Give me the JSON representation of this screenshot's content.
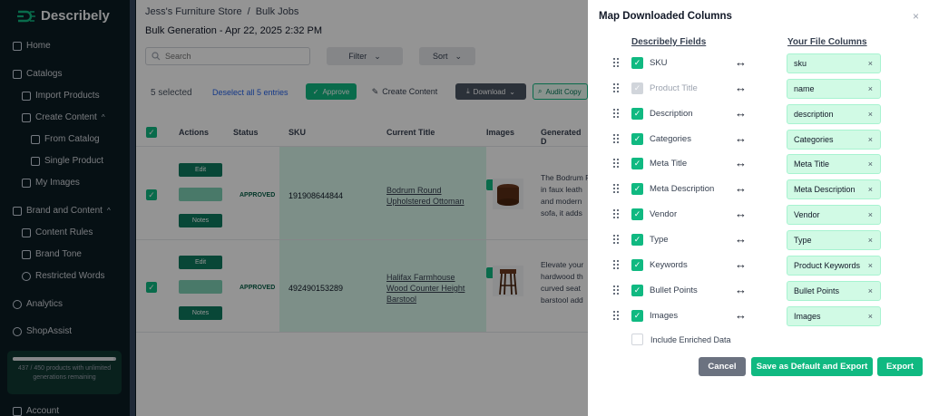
{
  "sidebar": {
    "brand": "Describely",
    "items": [
      {
        "label": "Home"
      },
      {
        "label": "Catalogs"
      },
      {
        "label": "Import Products"
      },
      {
        "label": "Create Content"
      },
      {
        "label": "From Catalog"
      },
      {
        "label": "Single Product"
      },
      {
        "label": "My Images"
      },
      {
        "label": "Brand and Content"
      },
      {
        "label": "Content Rules"
      },
      {
        "label": "Brand Tone"
      },
      {
        "label": "Restricted Words"
      },
      {
        "label": "Analytics"
      },
      {
        "label": "ShopAssist"
      },
      {
        "label": "Account"
      }
    ],
    "quota": {
      "text": "437 / 450 products with unlimited generations remaining",
      "used_fraction": 0.97
    }
  },
  "main": {
    "breadcrumb": {
      "store": "Jess's Furniture Store",
      "sep": "/",
      "page": "Bulk Jobs"
    },
    "title": "Bulk Generation - Apr 22, 2025 2:32 PM",
    "search_placeholder": "Search",
    "filter_label": "Filter",
    "sort_label": "Sort",
    "selection": {
      "count_text": "5 selected",
      "deselect_text": "Deselect all 5 entries"
    },
    "toolbar": {
      "approve": "Approve",
      "create_content": "Create Content",
      "download": "Download",
      "audit": "Audit Copy"
    },
    "columns": [
      "Actions",
      "Status",
      "SKU",
      "Current Title",
      "Images",
      "Generated D"
    ],
    "action_labels": {
      "edit": "Edit",
      "notes": "Notes"
    },
    "rows": [
      {
        "status": "APPROVED",
        "sku": "191908644844",
        "title": "Bodrum Round Upholstered Ottoman",
        "generated": [
          "The Bodrum R",
          "in faux leath",
          "and modern",
          "sofa, it adds"
        ]
      },
      {
        "status": "APPROVED",
        "sku": "492490153289",
        "title": "Halifax Farmhouse Wood Counter Height Barstool",
        "generated": [
          "Elevate your",
          "hardwood th",
          "curved seat",
          "barstool add"
        ]
      }
    ]
  },
  "modal": {
    "title": "Map Downloaded Columns",
    "close": "×",
    "left_header": "Describely Fields",
    "right_header": "Your File Columns",
    "arrow": "↔",
    "remove": "×",
    "fields": [
      {
        "field": "SKU",
        "column": "sku",
        "checked": true,
        "disabled": false
      },
      {
        "field": "Product Title",
        "column": "name",
        "checked": true,
        "disabled": true
      },
      {
        "field": "Description",
        "column": "description",
        "checked": true,
        "disabled": false
      },
      {
        "field": "Categories",
        "column": "Categories",
        "checked": true,
        "disabled": false
      },
      {
        "field": "Meta Title",
        "column": "Meta Title",
        "checked": true,
        "disabled": false
      },
      {
        "field": "Meta Description",
        "column": "Meta Description",
        "checked": true,
        "disabled": false
      },
      {
        "field": "Vendor",
        "column": "Vendor",
        "checked": true,
        "disabled": false
      },
      {
        "field": "Type",
        "column": "Type",
        "checked": true,
        "disabled": false
      },
      {
        "field": "Keywords",
        "column": "Product Keywords",
        "checked": true,
        "disabled": false
      },
      {
        "field": "Bullet Points",
        "column": "Bullet Points",
        "checked": true,
        "disabled": false
      },
      {
        "field": "Images",
        "column": "Images",
        "checked": true,
        "disabled": false
      }
    ],
    "include_enriched": {
      "label": "Include Enriched Data",
      "checked": false
    },
    "buttons": {
      "cancel": "Cancel",
      "save_default": "Save as Default and Export",
      "export": "Export"
    }
  },
  "colors": {
    "accent": "#10b981",
    "sidebar_bg": "#0c1d24",
    "field_bg": "#d1fae5"
  }
}
